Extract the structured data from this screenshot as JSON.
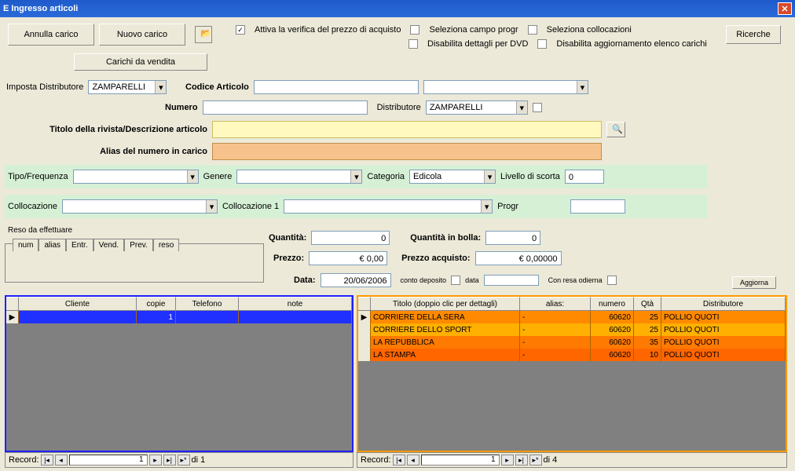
{
  "window": {
    "title": "E Ingresso articoli"
  },
  "toolbar": {
    "annulla": "Annulla carico",
    "nuovo": "Nuovo carico",
    "carichi": "Carichi da vendita",
    "ricerche": "Ricerche",
    "check_attiva": "Attiva la verifica del prezzo di acquisto",
    "check_seleziona_progr": "Seleziona campo progr",
    "check_seleziona_colloc": "Seleziona collocazioni",
    "check_dis_dvd": "Disabilita dettagli per DVD",
    "check_dis_agg": "Disabilita aggiornamento elenco carichi"
  },
  "form": {
    "imposta_dist_lbl": "Imposta Distributore",
    "imposta_dist_val": "ZAMPARELLI",
    "codice_lbl": "Codice Articolo",
    "codice_val": "",
    "numero_lbl": "Numero",
    "numero_val": "",
    "distrib_lbl": "Distributore",
    "distrib_val": "ZAMPARELLI",
    "titolo_lbl": "Titolo della rivista/Descrizione articolo",
    "titolo_val": "",
    "alias_lbl": "Alias del numero in carico",
    "alias_val": "",
    "tipo_lbl": "Tipo/Frequenza",
    "genere_lbl": "Genere",
    "categoria_lbl": "Categoria",
    "categoria_val": "Edicola",
    "livello_lbl": "Livello di scorta",
    "livello_val": "0",
    "colloc_lbl": "Collocazione",
    "colloc1_lbl": "Collocazione 1",
    "progr_lbl": "Progr",
    "quantita_lbl": "Quantità:",
    "quantita_val": "0",
    "quantita_bolla_lbl": "Quantità in bolla:",
    "quantita_bolla_val": "0",
    "prezzo_lbl": "Prezzo:",
    "prezzo_val": "€ 0,00",
    "prezzo_acq_lbl": "Prezzo acquisto:",
    "prezzo_acq_val": "€ 0,00000",
    "data_lbl": "Data:",
    "data_val": "20/06/2006",
    "conto_dep_lbl": "conto deposito",
    "data2_lbl": "data",
    "resa_lbl": "Con resa odierna",
    "aggiorna": "Aggiorna"
  },
  "tabs": {
    "reso_title": "Reso da effettuare",
    "t1": "num",
    "t2": "alias",
    "t3": "Entr.",
    "t4": "Vend.",
    "t5": "Prev.",
    "t6": "reso"
  },
  "leftgrid": {
    "record_lbl": "Record:",
    "record_idx": "1",
    "record_total": "di 1",
    "h_sel": "",
    "h1": "Cliente",
    "h2": "copie",
    "h3": "Telefono",
    "h4": "note",
    "row_empty": "1"
  },
  "rightgrid": {
    "record_lbl": "Record:",
    "record_idx": "1",
    "record_total": "di 4",
    "h_sel": "",
    "h1": "Titolo (doppio clic per dettagli)",
    "h2": "alias:",
    "h3": "numero",
    "h4": "Qtà",
    "h5": "Distributore",
    "rows": [
      {
        "titolo": "CORRIERE DELLA SERA",
        "alias": "-",
        "numero": "60620",
        "qta": "25",
        "dist": "POLLIO QUOTI"
      },
      {
        "titolo": "CORRIERE DELLO SPORT",
        "alias": "-",
        "numero": "60620",
        "qta": "25",
        "dist": "POLLIO QUOTI"
      },
      {
        "titolo": "LA REPUBBLICA",
        "alias": "-",
        "numero": "60620",
        "qta": "35",
        "dist": "POLLIO QUOTI"
      },
      {
        "titolo": "LA STAMPA",
        "alias": "-",
        "numero": "60620",
        "qta": "10",
        "dist": "POLLIO QUOTI"
      }
    ]
  }
}
